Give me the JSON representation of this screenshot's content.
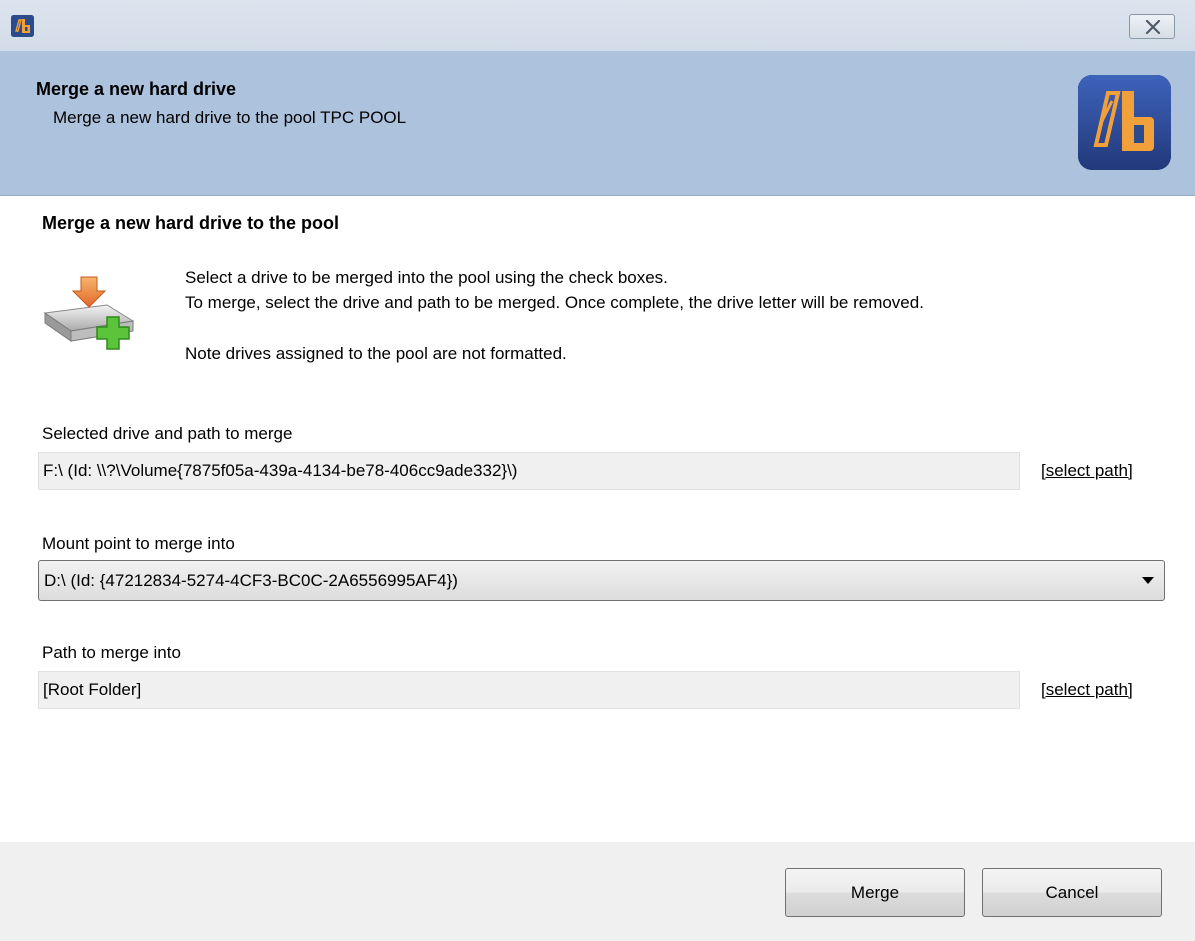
{
  "window": {
    "close_icon": "close-icon",
    "app_icon": "drivepool-app-icon"
  },
  "header": {
    "title": "Merge a new hard drive",
    "subtitle": "Merge a new hard drive to the pool TPC POOL",
    "logo_icon": "drivepool-logo",
    "background": "#adc2dd"
  },
  "main": {
    "section_title": "Merge a new hard drive to the pool",
    "icon": "add-drive-icon",
    "description": {
      "line1": "Select a drive to be merged into the pool using the check boxes.",
      "line2": "To merge, select the drive and path to be merged. Once complete, the drive letter will be removed.",
      "line3": "Note drives assigned to the pool are not formatted."
    },
    "selected_drive": {
      "label": "Selected drive and path to merge",
      "value": "F:\\   (Id: \\\\?\\Volume{7875f05a-439a-4134-be78-406cc9ade332}\\)",
      "link": "[select path]"
    },
    "mount_point": {
      "label": "Mount point to merge into",
      "value": "D:\\  (Id: {47212834-5274-4CF3-BC0C-2A6556995AF4})"
    },
    "path_into": {
      "label": "Path to merge into",
      "value": "[Root Folder]",
      "link": "[select path]"
    }
  },
  "footer": {
    "merge_label": "Merge",
    "cancel_label": "Cancel"
  }
}
